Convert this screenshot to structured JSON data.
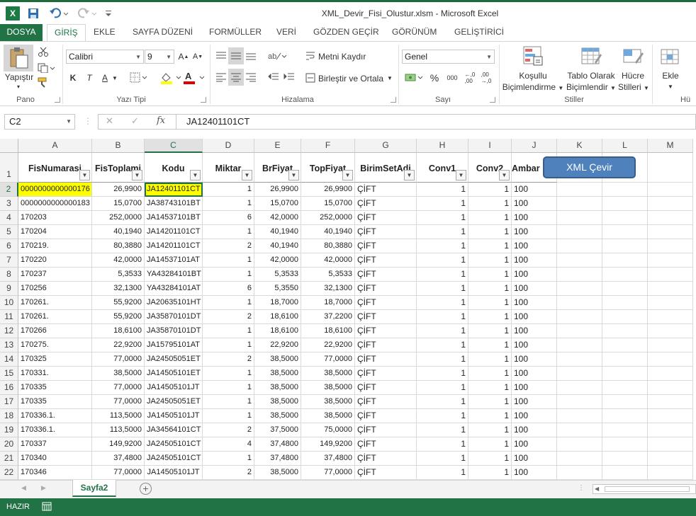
{
  "window": {
    "title": "XML_Devir_Fisi_Olustur.xlsm - Microsoft Excel",
    "logo_letter": "X"
  },
  "ribbon_tabs": [
    "DOSYA",
    "GİRİŞ",
    "EKLE",
    "SAYFA DÜZENİ",
    "FORMÜLLER",
    "VERİ",
    "GÖZDEN GEÇİR",
    "GÖRÜNÜM",
    "GELİŞTİRİCİ"
  ],
  "ribbon": {
    "clipboard": {
      "paste_label": "Yapıştır",
      "group_label": "Pano"
    },
    "font": {
      "name": "Calibri",
      "size": "9",
      "bold": "K",
      "italic": "T",
      "underline": "A",
      "group_label": "Yazı Tipi"
    },
    "alignment": {
      "wrap_text": "Metni Kaydır",
      "merge_center": "Birleştir ve Ortala",
      "group_label": "Hizalama"
    },
    "number": {
      "format": "Genel",
      "percent": "%",
      "comma": "000",
      "group_label": "Sayı"
    },
    "styles": {
      "conditional_line1": "Koşullu",
      "conditional_line2": "Biçimlendirme",
      "table_line1": "Tablo Olarak",
      "table_line2": "Biçimlendir",
      "cell_line1": "Hücre",
      "cell_line2": "Stilleri",
      "group_label": "Stiller"
    },
    "cells": {
      "insert_label": "Ekle",
      "group_label": "Hü"
    }
  },
  "formula_bar": {
    "name_box": "C2",
    "fx": "fx",
    "value": "JA12401101CT"
  },
  "sheet": {
    "columns": [
      "A",
      "B",
      "C",
      "D",
      "E",
      "F",
      "G",
      "H",
      "I",
      "J",
      "K",
      "L",
      "M"
    ],
    "headers": [
      "FisNumarasi",
      "FisToplami",
      "Kodu",
      "Miktar",
      "BrFiyat",
      "TopFiyat",
      "BirimSetAdi",
      "Conv1",
      "Conv2",
      "Ambar"
    ],
    "rows": [
      [
        "0000000000000176",
        "26,9900",
        "JA12401101CT",
        "1",
        "26,9900",
        "26,9900",
        "ÇİFT",
        "1",
        "1",
        "100"
      ],
      [
        "0000000000000183",
        "15,0700",
        "JA38743101BT",
        "1",
        "15,0700",
        "15,0700",
        "ÇİFT",
        "1",
        "1",
        "100"
      ],
      [
        "170203",
        "252,0000",
        "JA14537101BT",
        "6",
        "42,0000",
        "252,0000",
        "ÇİFT",
        "1",
        "1",
        "100"
      ],
      [
        "170204",
        "40,1940",
        "JA14201101CT",
        "1",
        "40,1940",
        "40,1940",
        "ÇİFT",
        "1",
        "1",
        "100"
      ],
      [
        "170219.",
        "80,3880",
        "JA14201101CT",
        "2",
        "40,1940",
        "80,3880",
        "ÇİFT",
        "1",
        "1",
        "100"
      ],
      [
        "170220",
        "42,0000",
        "JA14537101AT",
        "1",
        "42,0000",
        "42,0000",
        "ÇİFT",
        "1",
        "1",
        "100"
      ],
      [
        "170237",
        "5,3533",
        "YA43284101BT",
        "1",
        "5,3533",
        "5,3533",
        "ÇİFT",
        "1",
        "1",
        "100"
      ],
      [
        "170256",
        "32,1300",
        "YA43284101AT",
        "6",
        "5,3550",
        "32,1300",
        "ÇİFT",
        "1",
        "1",
        "100"
      ],
      [
        "170261.",
        "55,9200",
        "JA20635101HT",
        "1",
        "18,7000",
        "18,7000",
        "ÇİFT",
        "1",
        "1",
        "100"
      ],
      [
        "170261.",
        "55,9200",
        "JA35870101DT",
        "2",
        "18,6100",
        "37,2200",
        "ÇİFT",
        "1",
        "1",
        "100"
      ],
      [
        "170266",
        "18,6100",
        "JA35870101DT",
        "1",
        "18,6100",
        "18,6100",
        "ÇİFT",
        "1",
        "1",
        "100"
      ],
      [
        "170275.",
        "22,9200",
        "JA15795101AT",
        "1",
        "22,9200",
        "22,9200",
        "ÇİFT",
        "1",
        "1",
        "100"
      ],
      [
        "170325",
        "77,0000",
        "JA24505051ET",
        "2",
        "38,5000",
        "77,0000",
        "ÇİFT",
        "1",
        "1",
        "100"
      ],
      [
        "170331.",
        "38,5000",
        "JA14505101ET",
        "1",
        "38,5000",
        "38,5000",
        "ÇİFT",
        "1",
        "1",
        "100"
      ],
      [
        "170335",
        "77,0000",
        "JA14505101JT",
        "1",
        "38,5000",
        "38,5000",
        "ÇİFT",
        "1",
        "1",
        "100"
      ],
      [
        "170335",
        "77,0000",
        "JA24505051ET",
        "1",
        "38,5000",
        "38,5000",
        "ÇİFT",
        "1",
        "1",
        "100"
      ],
      [
        "170336.1.",
        "113,5000",
        "JA14505101JT",
        "1",
        "38,5000",
        "38,5000",
        "ÇİFT",
        "1",
        "1",
        "100"
      ],
      [
        "170336.1.",
        "113,5000",
        "JA34564101CT",
        "2",
        "37,5000",
        "75,0000",
        "ÇİFT",
        "1",
        "1",
        "100"
      ],
      [
        "170337",
        "149,9200",
        "JA24505101CT",
        "4",
        "37,4800",
        "149,9200",
        "ÇİFT",
        "1",
        "1",
        "100"
      ],
      [
        "170340",
        "37,4800",
        "JA24505101CT",
        "1",
        "37,4800",
        "37,4800",
        "ÇİFT",
        "1",
        "1",
        "100"
      ],
      [
        "170346",
        "77,0000",
        "JA14505101JT",
        "2",
        "38,5000",
        "77,0000",
        "ÇİFT",
        "1",
        "1",
        "100"
      ]
    ],
    "xml_button": "XML Çevir",
    "highlight_color": "#ffff00"
  },
  "sheet_tabs": {
    "active": "Sayfa2"
  },
  "status": {
    "mode": "HAZIR"
  }
}
